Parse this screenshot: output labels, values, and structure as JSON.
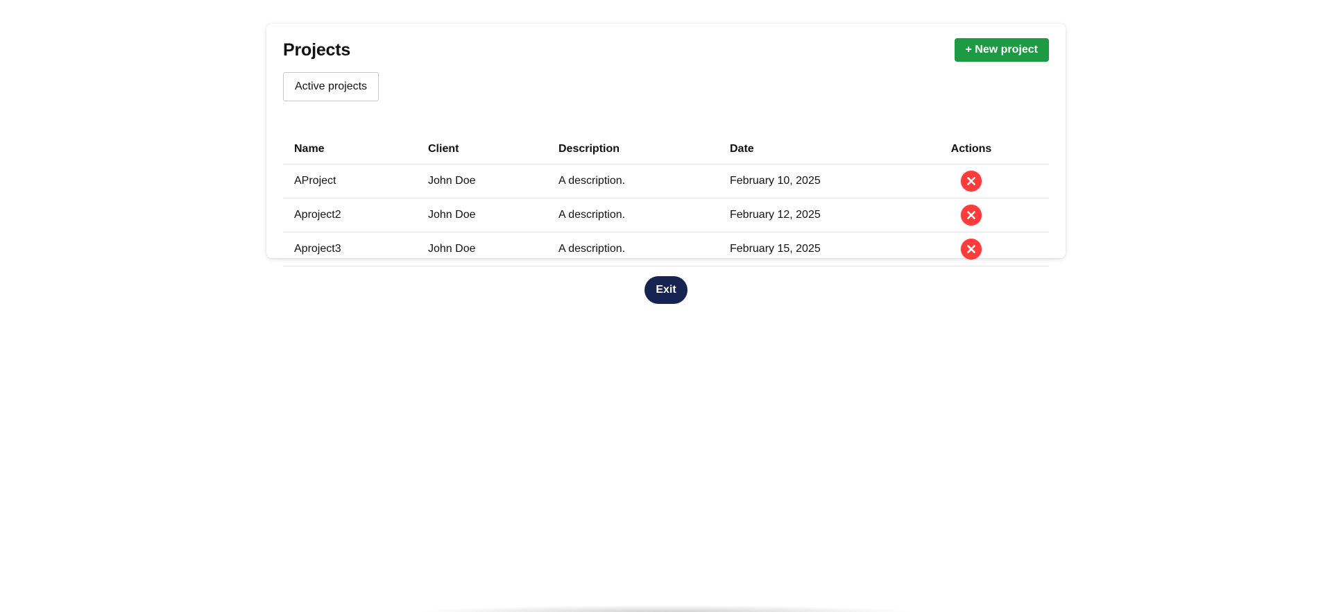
{
  "header": {
    "title": "Projects",
    "new_project_label": "+ New project"
  },
  "filter": {
    "label": "Active projects"
  },
  "table": {
    "columns": [
      "Name",
      "Client",
      "Description",
      "Date",
      "Actions"
    ],
    "rows": [
      {
        "name": "AProject",
        "client": "John Doe",
        "description": "A description.",
        "date": "February 10, 2025",
        "action_icon": "delete-x-icon"
      },
      {
        "name": "Aproject2",
        "client": "John Doe",
        "description": "A description.",
        "date": "February 12, 2025",
        "action_icon": "delete-x-icon"
      },
      {
        "name": "Aproject3",
        "client": "John Doe",
        "description": "A description.",
        "date": "February 15, 2025",
        "action_icon": "delete-x-icon"
      }
    ]
  },
  "footer": {
    "exit_label": "Exit"
  },
  "colors": {
    "primary_green": "#1e9a44",
    "delete_red": "#ff3b3b",
    "exit_navy": "#172350"
  }
}
